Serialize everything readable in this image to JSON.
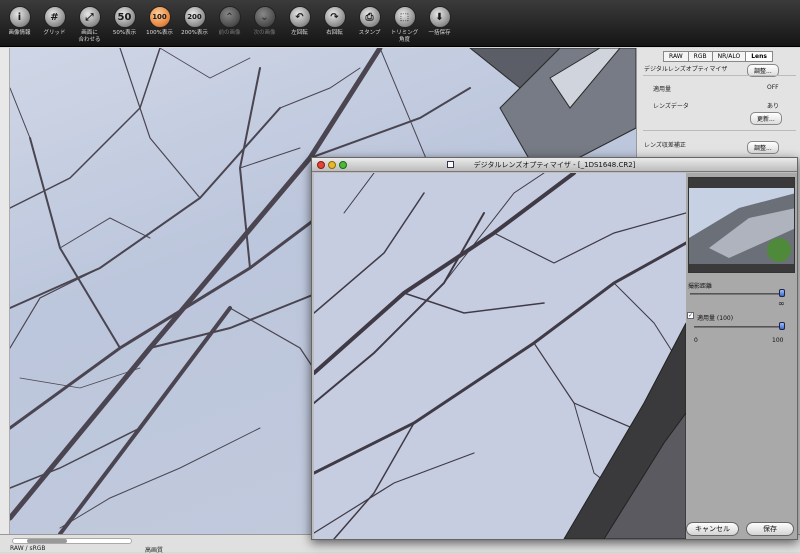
{
  "toolbar": {
    "buttons": [
      {
        "glyph": "i",
        "label": "画像情報",
        "state": "normal"
      },
      {
        "glyph": "#",
        "label": "グリッド",
        "state": "normal"
      },
      {
        "glyph": "⤢",
        "label": "画面に\n合わせる",
        "state": "normal"
      },
      {
        "glyph": "50",
        "label": "50%表示",
        "state": "normal"
      },
      {
        "glyph": "100",
        "label": "100%表示",
        "state": "active"
      },
      {
        "glyph": "200",
        "label": "200%表示",
        "state": "normal"
      },
      {
        "glyph": "⌃",
        "label": "前の画像",
        "state": "disabled"
      },
      {
        "glyph": "⌄",
        "label": "次の画像",
        "state": "disabled"
      },
      {
        "glyph": "↶",
        "label": "左回転",
        "state": "normal"
      },
      {
        "glyph": "↷",
        "label": "右回転",
        "state": "normal"
      },
      {
        "glyph": "⎙",
        "label": "スタンプ",
        "state": "normal"
      },
      {
        "glyph": "⬚",
        "label": "トリミング\n角度",
        "state": "normal"
      },
      {
        "glyph": "⬇",
        "label": "一括保存",
        "state": "normal"
      }
    ]
  },
  "panel": {
    "tabs": [
      "RAW",
      "RGB",
      "NR/ALO",
      "Lens"
    ],
    "active_tab": "Lens",
    "dlo_title": "デジタルレンズオプティマイザ",
    "adjust_label": "調整...",
    "apply_label": "適用量",
    "apply_value": "OFF",
    "lens_data_label": "レンズデータ",
    "lens_data_value": "あり",
    "update_label": "更新...",
    "aberration_label": "レンズ収差補正",
    "adjust2_label": "調整..."
  },
  "status": {
    "color_info": "RAW / sRGB",
    "quality": "高画質"
  },
  "dialog": {
    "title": "デジタルレンズオプティマイザ - [_1DS1648.CR2]",
    "distance_label": "撮影距離",
    "infinity": "∞",
    "apply_checkbox_label": "適用量 (100)",
    "apply_checked": true,
    "min_label": "0",
    "max_label": "100",
    "apply_amount": 100,
    "cancel_label": "キャンセル",
    "save_label": "保存"
  },
  "colors": {
    "active_button": "#e2813a",
    "slider_knob": "#3a6ad0",
    "close_light": "#e0443a",
    "min_light": "#e8b82c",
    "zoom_light": "#4fb83a"
  }
}
